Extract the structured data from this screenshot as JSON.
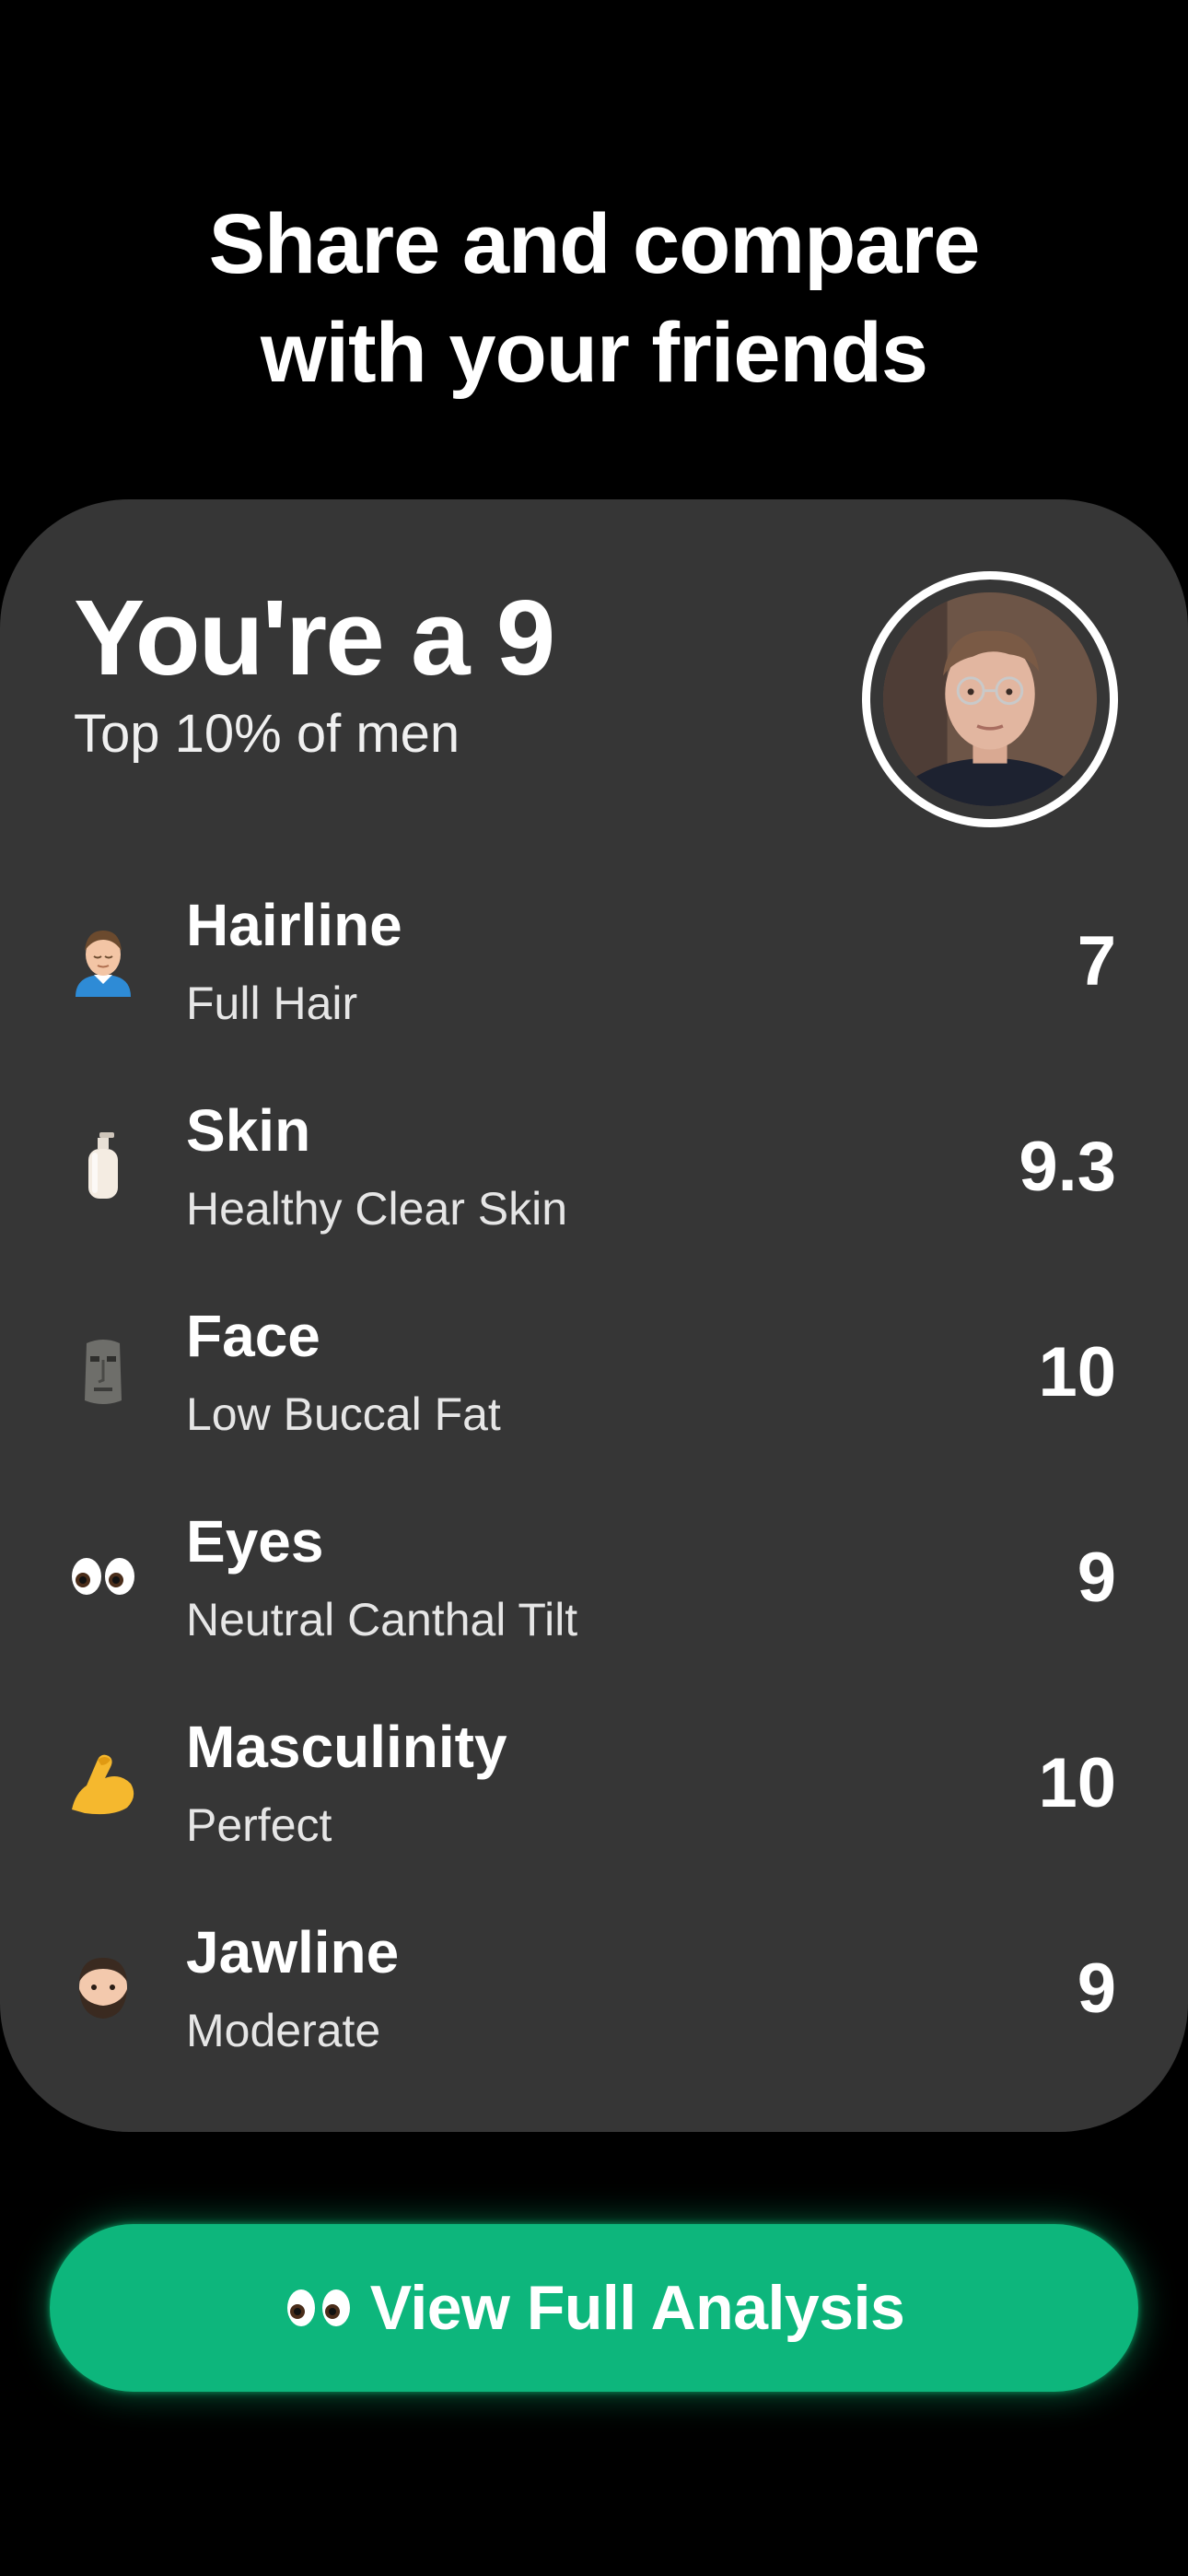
{
  "headline": {
    "line1": "Share and compare",
    "line2": "with your friends"
  },
  "card": {
    "score_title": "You're a 9",
    "score_subtitle": "Top 10% of men",
    "rows": [
      {
        "icon": "man-getting-haircut-icon",
        "title": "Hairline",
        "subtitle": "Full Hair",
        "score": "7"
      },
      {
        "icon": "lotion-bottle-icon",
        "title": "Skin",
        "subtitle": "Healthy  Clear Skin",
        "score": "9.3"
      },
      {
        "icon": "moai-icon",
        "title": "Face",
        "subtitle": "Low Buccal Fat",
        "score": "10"
      },
      {
        "icon": "eyes-icon",
        "title": "Eyes",
        "subtitle": "Neutral Canthal Tilt",
        "score": "9"
      },
      {
        "icon": "flexed-biceps-icon",
        "title": "Masculinity",
        "subtitle": "Perfect",
        "score": "10"
      },
      {
        "icon": "bearded-person-icon",
        "title": "Jawline",
        "subtitle": "Moderate",
        "score": "9"
      }
    ]
  },
  "cta": {
    "label": "View Full Analysis",
    "icon": "eyes-icon"
  },
  "colors": {
    "background": "#000000",
    "card": "#363636",
    "accent": "#0db67c"
  }
}
